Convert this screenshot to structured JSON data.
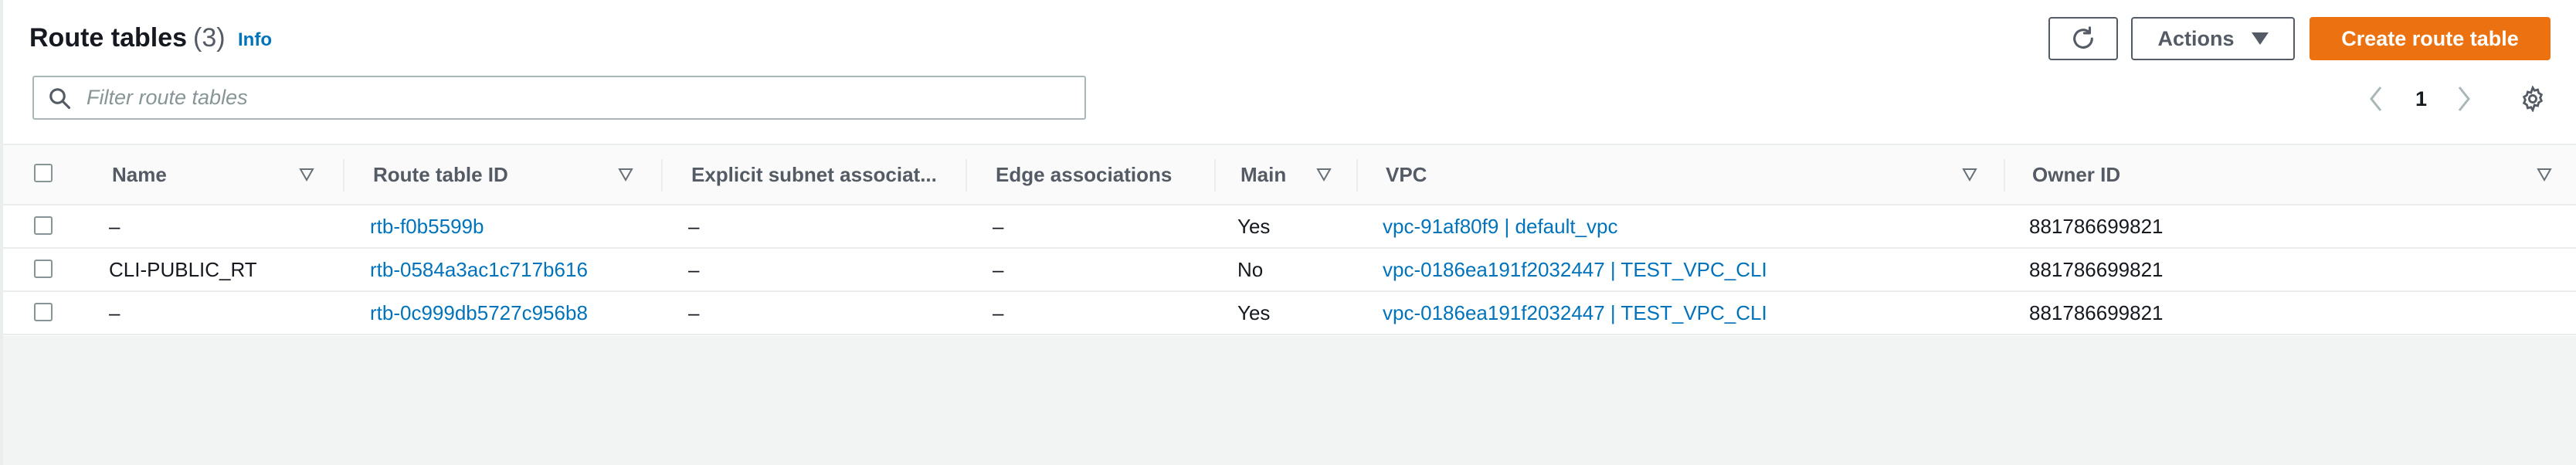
{
  "header": {
    "title": "Route tables",
    "count": "(3)",
    "info": "Info"
  },
  "toolbar": {
    "refresh_icon": "refresh-icon",
    "actions_label": "Actions",
    "create_label": "Create route table"
  },
  "search": {
    "placeholder": "Filter route tables",
    "value": ""
  },
  "pagination": {
    "page": "1"
  },
  "columns": [
    "Name",
    "Route table ID",
    "Explicit subnet associat...",
    "Edge associations",
    "Main",
    "VPC",
    "Owner ID"
  ],
  "rows": [
    {
      "name": "–",
      "route_table_id": "rtb-f0b5599b",
      "explicit_subnet": "–",
      "edge": "–",
      "main": "Yes",
      "vpc": "vpc-91af80f9 | default_vpc",
      "owner": "881786699821"
    },
    {
      "name": "CLI-PUBLIC_RT",
      "route_table_id": "rtb-0584a3ac1c717b616",
      "explicit_subnet": "–",
      "edge": "–",
      "main": "No",
      "vpc": "vpc-0186ea191f2032447 | TEST_VPC_CLI",
      "owner": "881786699821"
    },
    {
      "name": "–",
      "route_table_id": "rtb-0c999db5727c956b8",
      "explicit_subnet": "–",
      "edge": "–",
      "main": "Yes",
      "vpc": "vpc-0186ea191f2032447 | TEST_VPC_CLI",
      "owner": "881786699821"
    }
  ],
  "colors": {
    "primary": "#ec7211",
    "link": "#0073bb",
    "text": "#16191f",
    "muted": "#545b64"
  }
}
